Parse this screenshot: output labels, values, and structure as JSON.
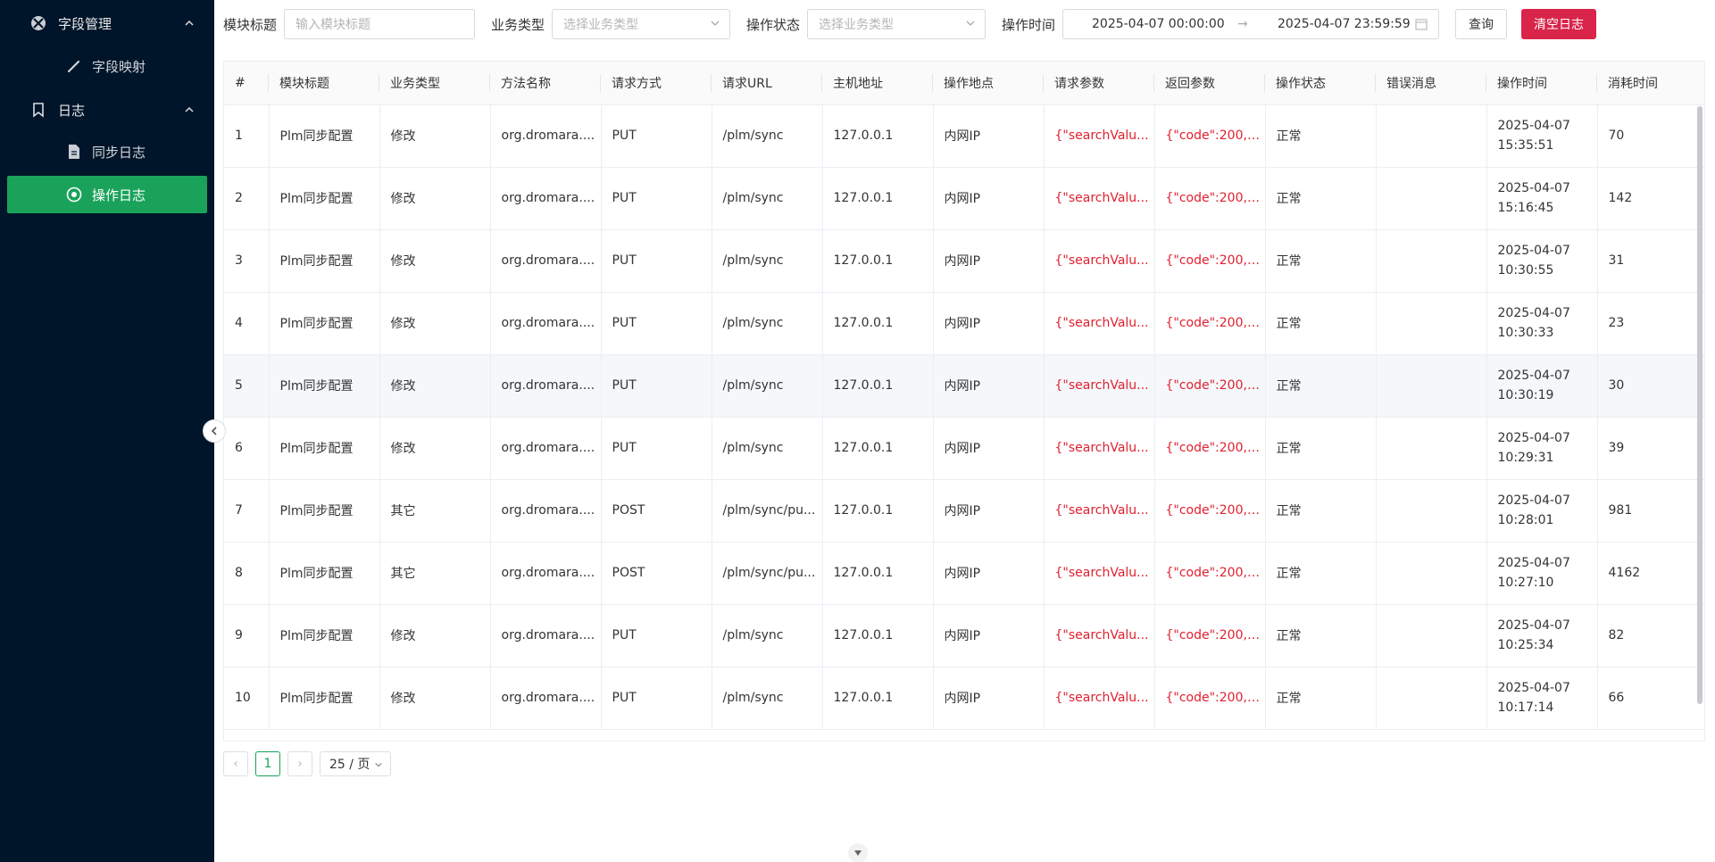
{
  "sidebar": {
    "group1": {
      "label": "字段管理",
      "icon": "xbox-icon",
      "expanded": true
    },
    "item_field_mapping": {
      "label": "字段映射",
      "icon": "pen-icon"
    },
    "group2": {
      "label": "日志",
      "icon": "bookmark-icon",
      "expanded": true
    },
    "item_sync_log": {
      "label": "同步日志",
      "icon": "file-icon"
    },
    "item_operation_log": {
      "label": "操作日志",
      "icon": "eye-icon",
      "active": true
    }
  },
  "filters": {
    "module_title_label": "模块标题",
    "module_title_placeholder": "输入模块标题",
    "business_type_label": "业务类型",
    "business_type_placeholder": "选择业务类型",
    "operation_status_label": "操作状态",
    "operation_status_placeholder": "选择业务类型",
    "operation_time_label": "操作时间",
    "date_start": "2025-04-07 00:00:00",
    "date_sep": "→",
    "date_end": "2025-04-07 23:59:59",
    "query_label": "查询",
    "clear_label": "清空日志"
  },
  "colors": {
    "sidebar_bg": "#001529",
    "active": "#1aa25a",
    "danger": "#d9254a",
    "red_text": "#e0202f"
  },
  "table": {
    "headers": [
      "#",
      "模块标题",
      "业务类型",
      "方法名称",
      "请求方式",
      "请求URL",
      "主机地址",
      "操作地点",
      "请求参数",
      "返回参数",
      "操作状态",
      "错误消息",
      "操作时间",
      "消耗时间"
    ],
    "rows": [
      {
        "no": "1",
        "module": "Plm同步配置",
        "btype": "修改",
        "method": "org.dromara....",
        "req": "PUT",
        "url": "/plm/sync",
        "host": "127.0.0.1",
        "loc": "内网IP",
        "params": "{\"searchValu...",
        "ret": "{\"code\":200,\"...",
        "status": "正常",
        "err": "",
        "date": "2025-04-07",
        "time": "15:35:51",
        "cost": "70"
      },
      {
        "no": "2",
        "module": "Plm同步配置",
        "btype": "修改",
        "method": "org.dromara....",
        "req": "PUT",
        "url": "/plm/sync",
        "host": "127.0.0.1",
        "loc": "内网IP",
        "params": "{\"searchValu...",
        "ret": "{\"code\":200,\"...",
        "status": "正常",
        "err": "",
        "date": "2025-04-07",
        "time": "15:16:45",
        "cost": "142"
      },
      {
        "no": "3",
        "module": "Plm同步配置",
        "btype": "修改",
        "method": "org.dromara....",
        "req": "PUT",
        "url": "/plm/sync",
        "host": "127.0.0.1",
        "loc": "内网IP",
        "params": "{\"searchValu...",
        "ret": "{\"code\":200,\"...",
        "status": "正常",
        "err": "",
        "date": "2025-04-07",
        "time": "10:30:55",
        "cost": "31"
      },
      {
        "no": "4",
        "module": "Plm同步配置",
        "btype": "修改",
        "method": "org.dromara....",
        "req": "PUT",
        "url": "/plm/sync",
        "host": "127.0.0.1",
        "loc": "内网IP",
        "params": "{\"searchValu...",
        "ret": "{\"code\":200,\"...",
        "status": "正常",
        "err": "",
        "date": "2025-04-07",
        "time": "10:30:33",
        "cost": "23"
      },
      {
        "no": "5",
        "module": "Plm同步配置",
        "btype": "修改",
        "method": "org.dromara....",
        "req": "PUT",
        "url": "/plm/sync",
        "host": "127.0.0.1",
        "loc": "内网IP",
        "params": "{\"searchValu...",
        "ret": "{\"code\":200,\"...",
        "status": "正常",
        "err": "",
        "date": "2025-04-07",
        "time": "10:30:19",
        "cost": "30",
        "highlight": true
      },
      {
        "no": "6",
        "module": "Plm同步配置",
        "btype": "修改",
        "method": "org.dromara....",
        "req": "PUT",
        "url": "/plm/sync",
        "host": "127.0.0.1",
        "loc": "内网IP",
        "params": "{\"searchValu...",
        "ret": "{\"code\":200,\"...",
        "status": "正常",
        "err": "",
        "date": "2025-04-07",
        "time": "10:29:31",
        "cost": "39"
      },
      {
        "no": "7",
        "module": "Plm同步配置",
        "btype": "其它",
        "method": "org.dromara....",
        "req": "POST",
        "url": "/plm/sync/pu...",
        "host": "127.0.0.1",
        "loc": "内网IP",
        "params": "{\"searchValu...",
        "ret": "{\"code\":200,\"...",
        "status": "正常",
        "err": "",
        "date": "2025-04-07",
        "time": "10:28:01",
        "cost": "981"
      },
      {
        "no": "8",
        "module": "Plm同步配置",
        "btype": "其它",
        "method": "org.dromara....",
        "req": "POST",
        "url": "/plm/sync/pu...",
        "host": "127.0.0.1",
        "loc": "内网IP",
        "params": "{\"searchValu...",
        "ret": "{\"code\":200,\"...",
        "status": "正常",
        "err": "",
        "date": "2025-04-07",
        "time": "10:27:10",
        "cost": "4162"
      },
      {
        "no": "9",
        "module": "Plm同步配置",
        "btype": "修改",
        "method": "org.dromara....",
        "req": "PUT",
        "url": "/plm/sync",
        "host": "127.0.0.1",
        "loc": "内网IP",
        "params": "{\"searchValu...",
        "ret": "{\"code\":200,\"...",
        "status": "正常",
        "err": "",
        "date": "2025-04-07",
        "time": "10:25:34",
        "cost": "82"
      },
      {
        "no": "10",
        "module": "Plm同步配置",
        "btype": "修改",
        "method": "org.dromara....",
        "req": "PUT",
        "url": "/plm/sync",
        "host": "127.0.0.1",
        "loc": "内网IP",
        "params": "{\"searchValu...",
        "ret": "{\"code\":200,\"...",
        "status": "正常",
        "err": "",
        "date": "2025-04-07",
        "time": "10:17:14",
        "cost": "66"
      }
    ]
  },
  "pagination": {
    "prev": "‹",
    "current": "1",
    "next": "›",
    "page_size": "25 / 页"
  }
}
